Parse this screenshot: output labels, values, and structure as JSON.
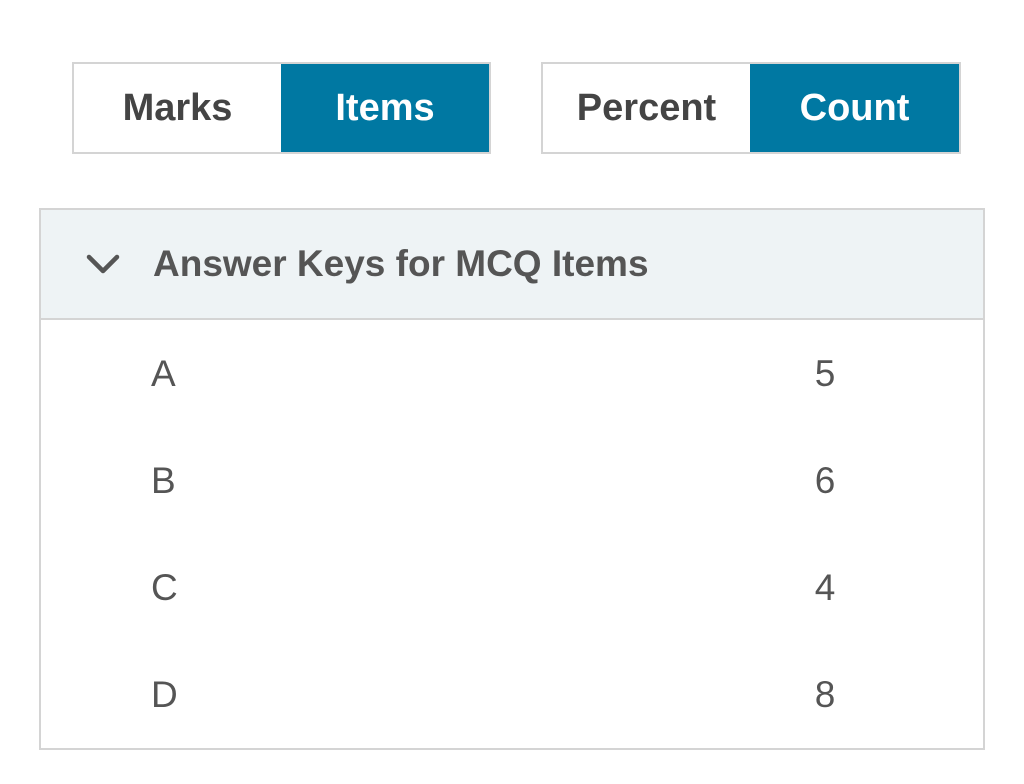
{
  "view_toggle": {
    "options": [
      {
        "label": "Marks",
        "active": false
      },
      {
        "label": "Items",
        "active": true
      }
    ]
  },
  "metric_toggle": {
    "options": [
      {
        "label": "Percent",
        "active": false
      },
      {
        "label": "Count",
        "active": true
      }
    ]
  },
  "panel": {
    "title": "Answer Keys for MCQ Items",
    "expanded": true,
    "icon": "chevron-down-icon",
    "rows": [
      {
        "key": "A",
        "value": "5"
      },
      {
        "key": "B",
        "value": "6"
      },
      {
        "key": "C",
        "value": "4"
      },
      {
        "key": "D",
        "value": "8"
      }
    ]
  },
  "colors": {
    "accent": "#0078a2",
    "header_bg": "#eef3f5",
    "border": "#d4d4d4",
    "text": "#4a4a4a"
  }
}
